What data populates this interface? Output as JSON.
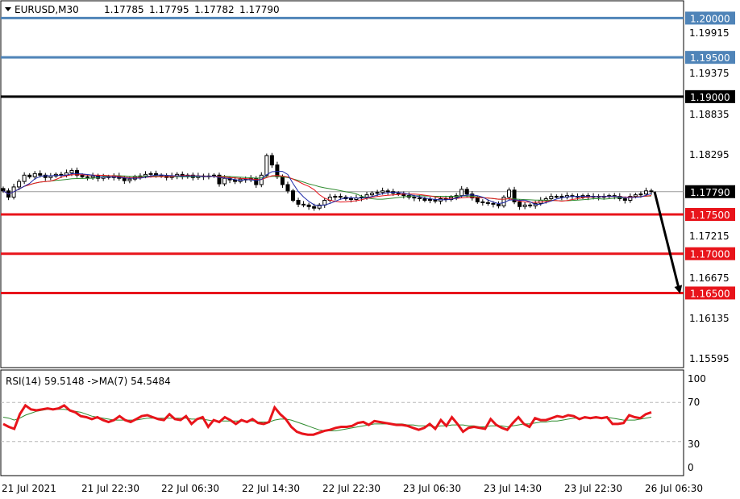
{
  "chart_data": [
    {
      "type": "candlestick",
      "symbol_line": {
        "symbol": "EURUSD,M30",
        "open": "1.17785",
        "high": "1.17795",
        "low": "1.17782",
        "close": "1.17790"
      },
      "price_axis_ticks": [
        "1.19915",
        "1.19375",
        "1.18835",
        "1.18295",
        "1.17215",
        "1.16675",
        "1.16135",
        "1.15595"
      ],
      "ylim": [
        1.1555,
        1.2022
      ],
      "current_price": 1.1779,
      "current_price_label": "1.17790",
      "horizontal_levels": [
        {
          "value": 1.2,
          "label": "1.20000",
          "color": "#4f84b8"
        },
        {
          "value": 1.195,
          "label": "1.19500",
          "color": "#4f84b8"
        },
        {
          "value": 1.19,
          "label": "1.19000",
          "color": "#000000"
        },
        {
          "value": 1.175,
          "label": "1.17500",
          "color": "#e8141b"
        },
        {
          "value": 1.17,
          "label": "1.17000",
          "color": "#e8141b"
        },
        {
          "value": 1.165,
          "label": "1.16500",
          "color": "#e8141b"
        }
      ],
      "arrow": {
        "from_price": 1.1779,
        "to_price": 1.165,
        "direction": "down"
      },
      "bars_per_session": 16,
      "x_tick_labels": [
        "21 Jul 2021",
        "21 Jul 22:30",
        "22 Jul 06:30",
        "22 Jul 14:30",
        "22 Jul 22:30",
        "23 Jul 06:30",
        "23 Jul 14:30",
        "23 Jul 22:30",
        "26 Jul 06:30"
      ],
      "close_series": [
        1.178,
        1.1772,
        1.1785,
        1.1792,
        1.18,
        1.1798,
        1.1802,
        1.18,
        1.1797,
        1.1799,
        1.1801,
        1.18,
        1.1803,
        1.1806,
        1.18,
        1.1798,
        1.1797,
        1.1799,
        1.1796,
        1.1798,
        1.1797,
        1.1799,
        1.1796,
        1.1793,
        1.1795,
        1.1798,
        1.1799,
        1.1801,
        1.1802,
        1.18,
        1.1799,
        1.1797,
        1.1799,
        1.1801,
        1.1798,
        1.18,
        1.1797,
        1.1799,
        1.1798,
        1.1799,
        1.18,
        1.1789,
        1.1796,
        1.1794,
        1.1792,
        1.1795,
        1.1794,
        1.1796,
        1.1788,
        1.18,
        1.1825,
        1.1813,
        1.1798,
        1.1788,
        1.178,
        1.1768,
        1.1763,
        1.1762,
        1.176,
        1.1758,
        1.1762,
        1.1768,
        1.1772,
        1.1773,
        1.1772,
        1.177,
        1.1769,
        1.1771,
        1.1772,
        1.1775,
        1.1777,
        1.1778,
        1.178,
        1.1779,
        1.1777,
        1.1776,
        1.1774,
        1.1772,
        1.1771,
        1.177,
        1.1768,
        1.1769,
        1.1767,
        1.177,
        1.1769,
        1.1772,
        1.1774,
        1.1782,
        1.1776,
        1.1771,
        1.1766,
        1.1765,
        1.1764,
        1.1763,
        1.1761,
        1.1772,
        1.1781,
        1.1766,
        1.176,
        1.1762,
        1.1761,
        1.1764,
        1.1768,
        1.177,
        1.1773,
        1.1773,
        1.1772,
        1.1774,
        1.1773,
        1.1772,
        1.1774,
        1.1772,
        1.1773,
        1.1772,
        1.1773,
        1.1774,
        1.1773,
        1.177,
        1.1768,
        1.1773,
        1.1775,
        1.1776,
        1.178,
        1.1779
      ]
    },
    {
      "type": "line",
      "label": "RSI(14) 59.5148  ->MA(7) 54.5484",
      "y_ticks": [
        "100",
        "70",
        "30",
        "0"
      ],
      "levels": [
        70,
        30
      ],
      "ylim": [
        0,
        100
      ],
      "series": [
        {
          "name": "RSI(14)",
          "color": "#e8141b",
          "values": [
            48,
            45,
            43,
            58,
            67,
            63,
            62,
            63,
            64,
            63,
            64,
            67,
            62,
            60,
            56,
            55,
            53,
            55,
            52,
            50,
            52,
            56,
            52,
            50,
            53,
            56,
            57,
            55,
            53,
            52,
            58,
            53,
            52,
            56,
            48,
            53,
            55,
            45,
            52,
            50,
            55,
            52,
            48,
            52,
            50,
            53,
            49,
            48,
            50,
            65,
            58,
            53,
            45,
            40,
            38,
            37,
            37,
            39,
            41,
            42,
            44,
            45,
            45,
            46,
            49,
            50,
            47,
            51,
            50,
            49,
            48,
            47,
            47,
            46,
            44,
            42,
            44,
            48,
            43,
            52,
            46,
            55,
            48,
            40,
            44,
            45,
            44,
            43,
            53,
            47,
            44,
            42,
            49,
            55,
            48,
            45,
            54,
            52,
            52,
            54,
            56,
            55,
            57,
            56,
            53,
            55,
            54,
            55,
            54,
            55,
            48,
            48,
            49,
            57,
            55,
            54,
            58,
            60
          ]
        },
        {
          "name": "MA(7)",
          "color": "#2e8b2e",
          "values": [
            55,
            54,
            52,
            54,
            57,
            59,
            61,
            62,
            63,
            63,
            63,
            63,
            62,
            61,
            60,
            58,
            56,
            55,
            54,
            53,
            52,
            52,
            52,
            52,
            52,
            53,
            54,
            54,
            54,
            54,
            54,
            54,
            54,
            54,
            53,
            53,
            53,
            52,
            51,
            51,
            51,
            51,
            51,
            51,
            51,
            51,
            50,
            50,
            50,
            52,
            53,
            53,
            52,
            50,
            48,
            46,
            44,
            42,
            41,
            41,
            41,
            42,
            43,
            44,
            45,
            46,
            47,
            48,
            48,
            48,
            48,
            48,
            48,
            47,
            47,
            46,
            46,
            46,
            45,
            46,
            46,
            47,
            47,
            47,
            46,
            46,
            45,
            45,
            46,
            46,
            46,
            45,
            46,
            47,
            48,
            48,
            49,
            50,
            50,
            51,
            51,
            52,
            53,
            54,
            54,
            54,
            54,
            54,
            54,
            55,
            54,
            53,
            52,
            52,
            52,
            53,
            54,
            55
          ]
        }
      ]
    }
  ]
}
